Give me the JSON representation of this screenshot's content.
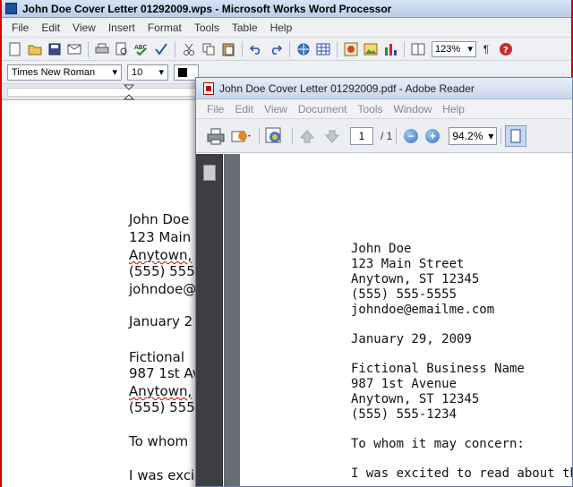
{
  "works": {
    "title": "John Doe Cover Letter 01292009.wps - Microsoft Works Word Processor",
    "menu": [
      "File",
      "Edit",
      "View",
      "Insert",
      "Format",
      "Tools",
      "Table",
      "Help"
    ],
    "zoom": "123%",
    "font_name": "Times New Roman",
    "font_size": "10",
    "document_lines": [
      "John Doe",
      "123 Main",
      "Anytown,",
      "(555) 555",
      "johndoe@",
      "January 2",
      "Fictional",
      "987 1st Ave",
      "Anytown,",
      "(555) 555",
      "To whom",
      "I was exci"
    ]
  },
  "reader": {
    "title": "John Doe Cover Letter 01292009.pdf - Adobe Reader",
    "menu": [
      "File",
      "Edit",
      "View",
      "Document",
      "Tools",
      "Window",
      "Help"
    ],
    "page_current": "1",
    "page_total_label": "/ 1",
    "zoom": "94.2%",
    "document_lines": [
      "John Doe",
      "123 Main Street",
      "Anytown, ST  12345",
      "(555) 555-5555",
      "johndoe@emailme.com",
      "January 29, 2009",
      "Fictional Business Name",
      "987 1st Avenue",
      "Anytown, ST  12345",
      "(555) 555-1234",
      "To whom it may concern:",
      "I was excited to read about the gen"
    ]
  }
}
